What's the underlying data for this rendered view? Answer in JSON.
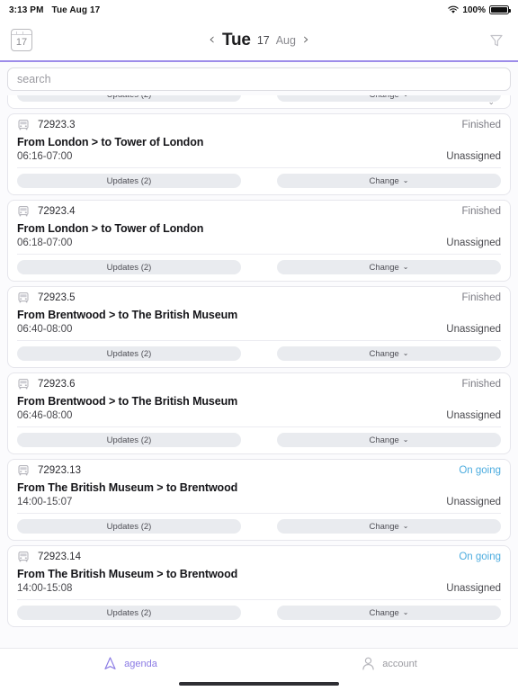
{
  "status_bar": {
    "time": "3:13 PM",
    "date": "Tue Aug 17",
    "battery_percent": "100%",
    "wifi_icon": "wifi-icon",
    "battery_icon": "battery-full-icon"
  },
  "header": {
    "calendar_icon": "calendar-icon",
    "calendar_day": "17",
    "prev_label": "‹",
    "next_label": "›",
    "day_name": "Tue",
    "day_number": "17",
    "month": "Aug",
    "filter_icon": "filter-funnel-icon"
  },
  "accent_color": "#9d8ce9",
  "search": {
    "placeholder": "search",
    "value": ""
  },
  "labels": {
    "updates": "Updates (2)",
    "change": "Change",
    "caret": "⌄",
    "vehicle_icon": "bus-icon"
  },
  "trips": [
    {
      "id": "",
      "title": "",
      "time": "",
      "status": "",
      "assignee": "",
      "partial": true
    },
    {
      "id": "72923.3",
      "title": "From London > to Tower of London",
      "time": "06:16-07:00",
      "status": "Finished",
      "assignee": "Unassigned",
      "partial": false
    },
    {
      "id": "72923.4",
      "title": "From London > to Tower of London",
      "time": "06:18-07:00",
      "status": "Finished",
      "assignee": "Unassigned",
      "partial": false
    },
    {
      "id": "72923.5",
      "title": "From Brentwood > to The British Museum",
      "time": "06:40-08:00",
      "status": "Finished",
      "assignee": "Unassigned",
      "partial": false
    },
    {
      "id": "72923.6",
      "title": "From Brentwood > to The British Museum",
      "time": "06:46-08:00",
      "status": "Finished",
      "assignee": "Unassigned",
      "partial": false
    },
    {
      "id": "72923.13",
      "title": "From The British Museum > to Brentwood",
      "time": "14:00-15:07",
      "status": "On going",
      "assignee": "Unassigned",
      "partial": false
    },
    {
      "id": "72923.14",
      "title": "From The British Museum > to Brentwood",
      "time": "14:00-15:08",
      "status": "On going",
      "assignee": "Unassigned",
      "partial": false
    }
  ],
  "status_colors": {
    "finished": "#7c7c84",
    "ongoing": "#4cacdf"
  },
  "tabbar": {
    "items": [
      {
        "label": "agenda",
        "icon": "navigation-triangle-icon",
        "active": true
      },
      {
        "label": "account",
        "icon": "person-icon",
        "active": false
      }
    ]
  }
}
